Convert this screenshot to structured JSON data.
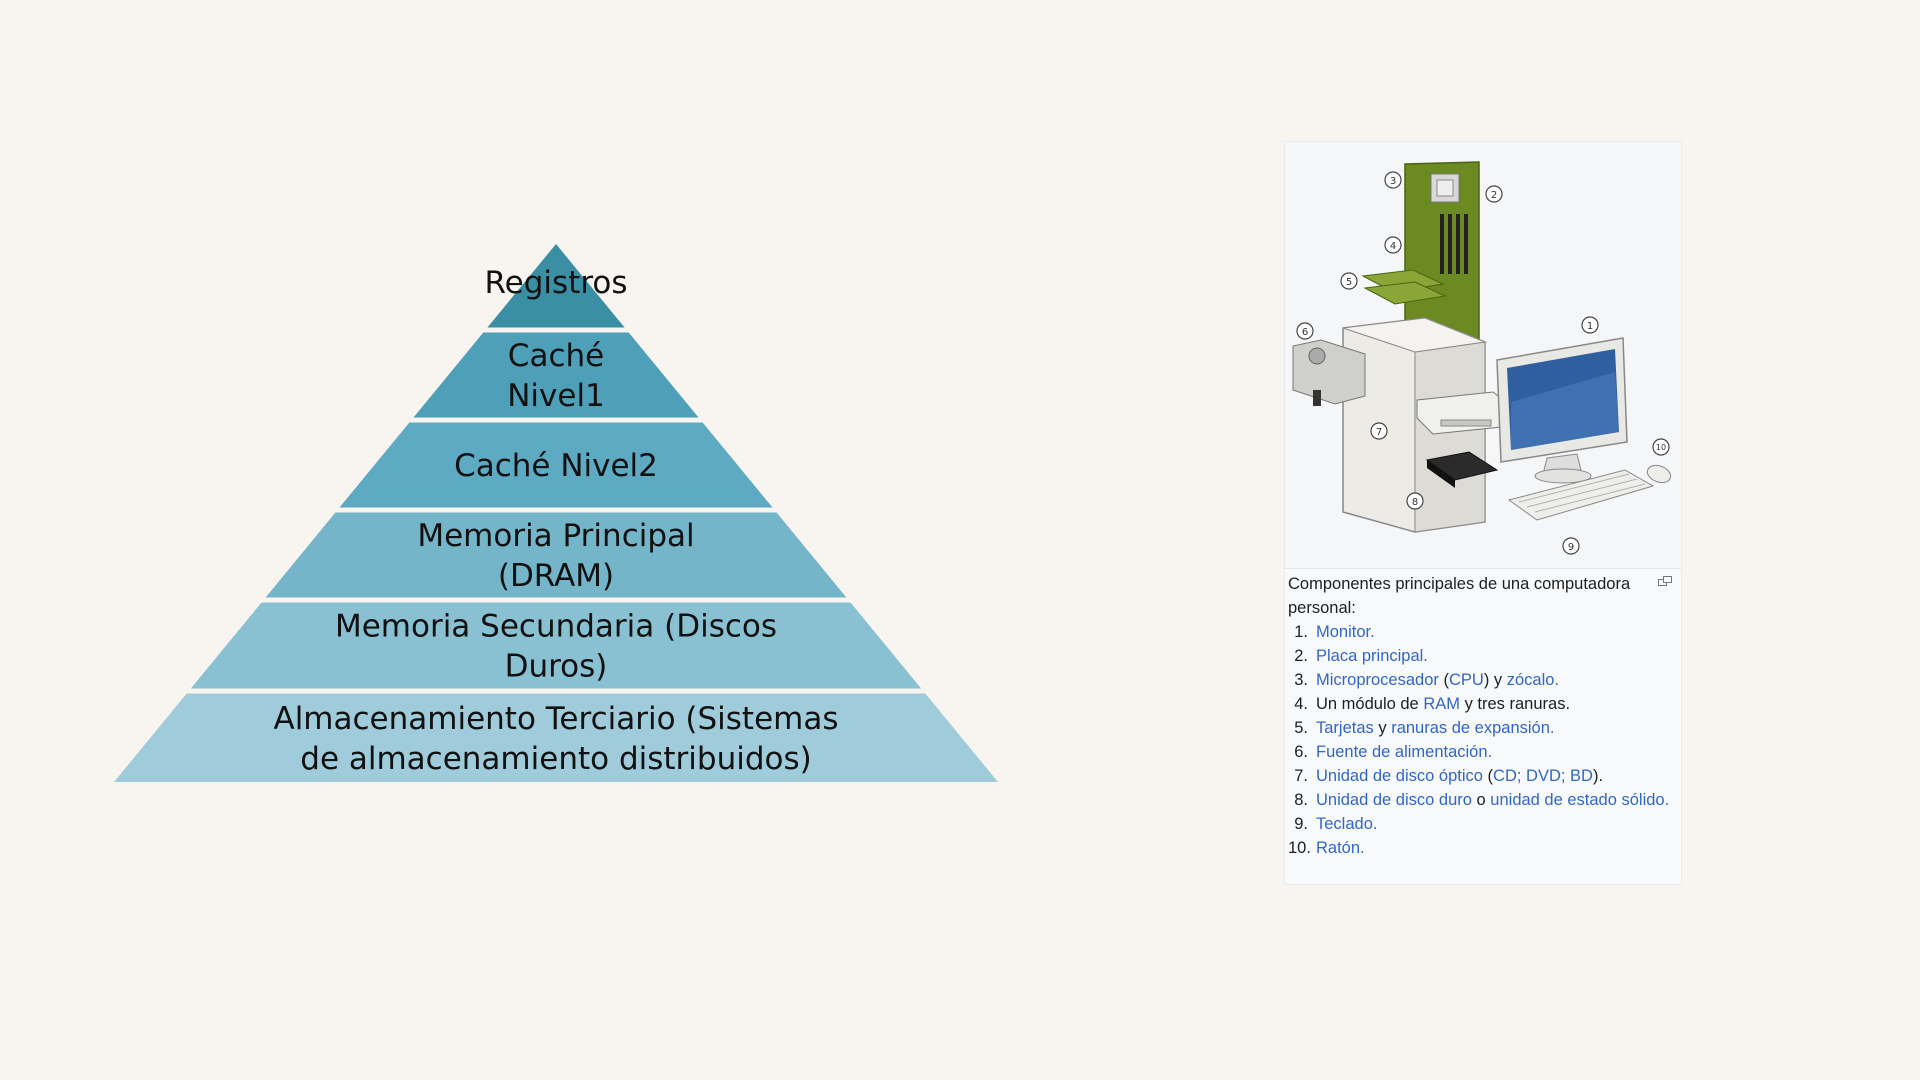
{
  "pyramid": {
    "tiers": [
      {
        "lines": [
          "Registros"
        ],
        "color": "#3b8fa5"
      },
      {
        "lines": [
          "Caché",
          "Nivel1"
        ],
        "color": "#4ea0b9"
      },
      {
        "lines": [
          "Caché Nivel2"
        ],
        "color": "#5eaac3"
      },
      {
        "lines": [
          "Memoria Principal",
          "(DRAM)"
        ],
        "color": "#74b5ca"
      },
      {
        "lines": [
          "Memoria Secundaria (Discos",
          "Duros)"
        ],
        "color": "#89c1d3"
      },
      {
        "lines": [
          "Almacenamiento Terciario (Sistemas",
          "de almacenamiento distribuidos)"
        ],
        "color": "#9fcbdb"
      }
    ]
  },
  "infobox": {
    "image_icon": "computer-components-illustration",
    "callouts": [
      "1",
      "2",
      "3",
      "4",
      "5",
      "6",
      "7",
      "8",
      "9",
      "10"
    ],
    "caption_intro": "Componentes principales de una computadora personal:",
    "enlarge_icon": "enlarge-icon",
    "items": [
      {
        "num": "1.",
        "parts": [
          {
            "text": "Monitor.",
            "link": true
          }
        ]
      },
      {
        "num": "2.",
        "parts": [
          {
            "text": "Placa principal.",
            "link": true
          }
        ]
      },
      {
        "num": "3.",
        "parts": [
          {
            "text": "Microprocesador",
            "link": true
          },
          {
            "text": " (",
            "link": false
          },
          {
            "text": "CPU",
            "link": true
          },
          {
            "text": ") y ",
            "link": false
          },
          {
            "text": "zócalo.",
            "link": true
          }
        ]
      },
      {
        "num": "4.",
        "parts": [
          {
            "text": "Un módulo de ",
            "link": false
          },
          {
            "text": "RAM",
            "link": true
          },
          {
            "text": " y tres ranuras.",
            "link": false
          }
        ]
      },
      {
        "num": "5.",
        "parts": [
          {
            "text": "Tarjetas",
            "link": true
          },
          {
            "text": " y ",
            "link": false
          },
          {
            "text": "ranuras de expansión.",
            "link": true
          }
        ]
      },
      {
        "num": "6.",
        "parts": [
          {
            "text": "Fuente de alimentación.",
            "link": true
          }
        ]
      },
      {
        "num": "7.",
        "parts": [
          {
            "text": "Unidad de disco óptico",
            "link": true
          },
          {
            "text": " (",
            "link": false
          },
          {
            "text": "CD; DVD; BD",
            "link": true
          },
          {
            "text": ").",
            "link": false
          }
        ]
      },
      {
        "num": "8.",
        "parts": [
          {
            "text": "Unidad de disco duro",
            "link": true
          },
          {
            "text": " o ",
            "link": false
          },
          {
            "text": "unidad de estado sólido.",
            "link": true
          }
        ]
      },
      {
        "num": "9.",
        "parts": [
          {
            "text": "Teclado.",
            "link": true
          }
        ]
      },
      {
        "num": "10.",
        "parts": [
          {
            "text": "Ratón.",
            "link": true
          }
        ]
      }
    ]
  },
  "colors": {
    "background": "#f8f5f0",
    "link": "#3366cc",
    "board": "#6b8a22",
    "monitor_screen": "#2f5f9e"
  }
}
